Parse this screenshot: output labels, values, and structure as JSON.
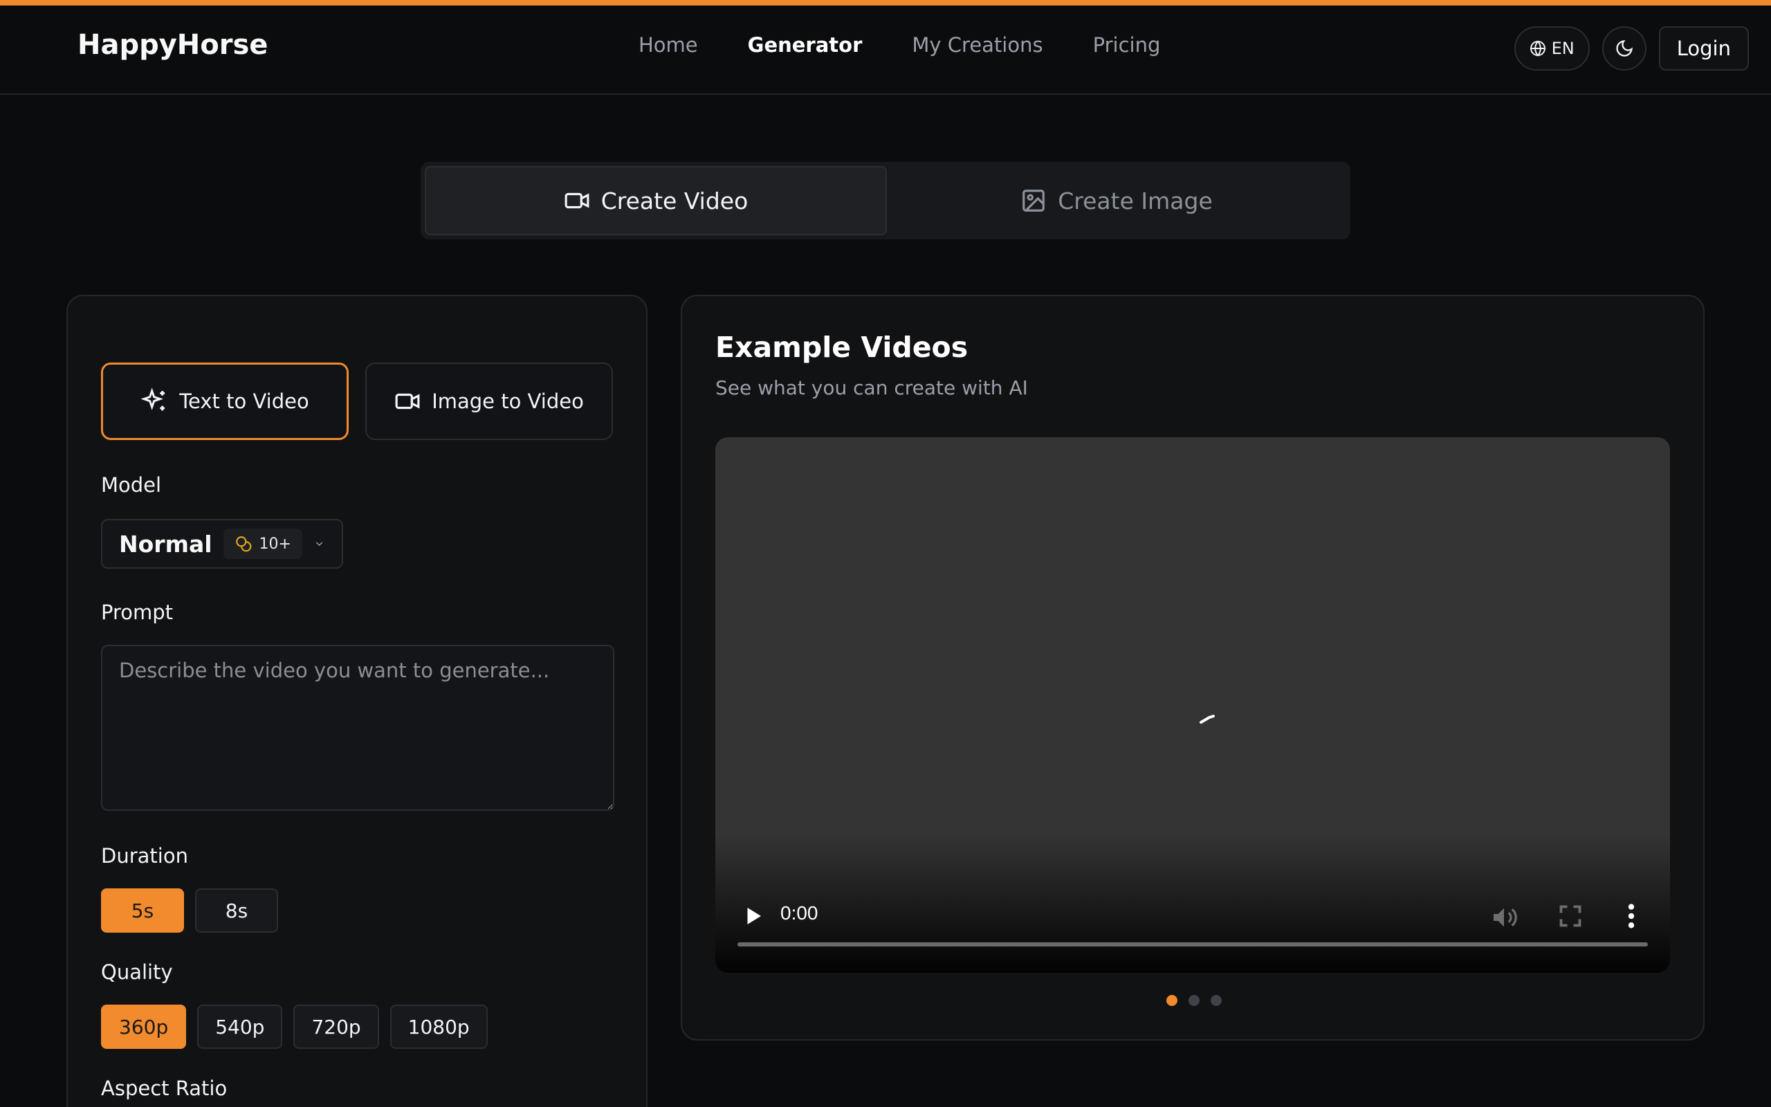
{
  "header": {
    "logo": "HappyHorse",
    "nav": [
      "Home",
      "Generator",
      "My Creations",
      "Pricing"
    ],
    "language": "EN",
    "login_label": "Login"
  },
  "mode_tabs": [
    "Create Video",
    "Create Image"
  ],
  "left": {
    "gen_types": [
      "Text to Video",
      "Image to Video"
    ],
    "model_label": "Model",
    "model_value": "Normal",
    "model_credits": "10+",
    "prompt_label": "Prompt",
    "prompt_placeholder": "Describe the video you want to generate...",
    "duration_label": "Duration",
    "durations": [
      "5s",
      "8s"
    ],
    "quality_label": "Quality",
    "qualities": [
      "360p",
      "540p",
      "720p",
      "1080p"
    ],
    "aspect_label": "Aspect Ratio"
  },
  "right": {
    "title": "Example Videos",
    "subtitle": "See what you can create with AI",
    "video_time": "0:00"
  },
  "colors": {
    "accent": "#f28a2e",
    "background": "#0b0c0e",
    "panel": "#111214"
  }
}
